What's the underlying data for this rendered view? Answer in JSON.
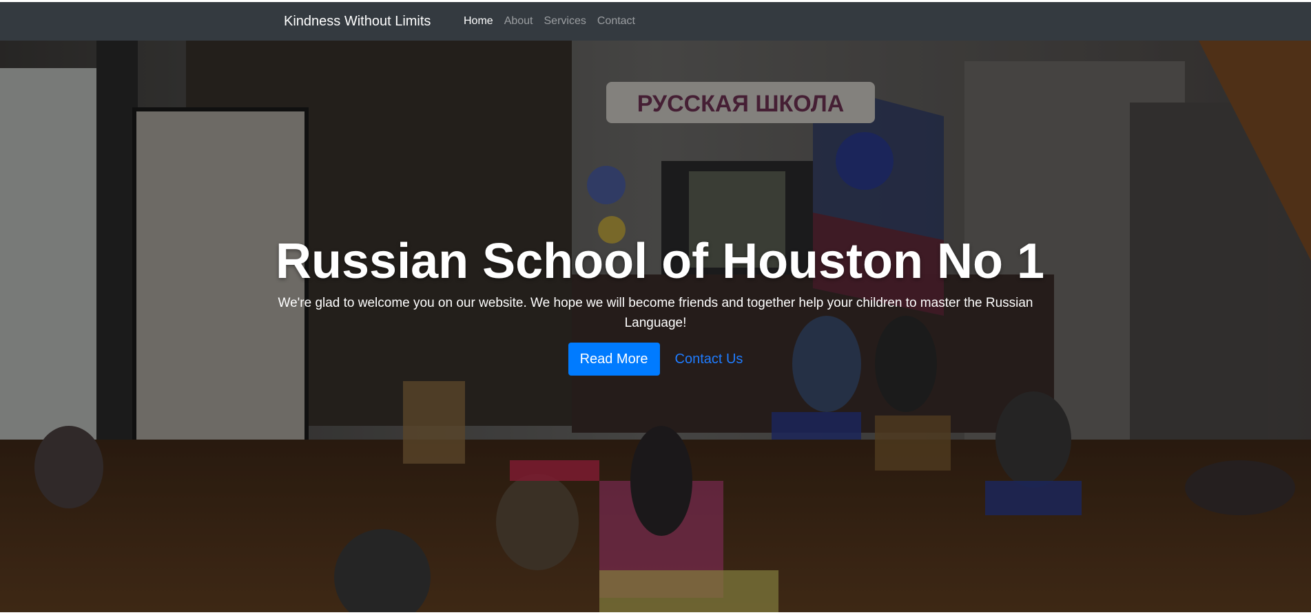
{
  "navbar": {
    "brand": "Kindness Without Limits",
    "links": [
      {
        "label": "Home",
        "active": true
      },
      {
        "label": "About",
        "active": false
      },
      {
        "label": "Services",
        "active": false
      },
      {
        "label": "Contact",
        "active": false
      }
    ]
  },
  "hero": {
    "title": "Russian School of Houston No 1",
    "text": "We're glad to welcome you on our website. We hope we will become friends and together help your children to master the Russian Language!",
    "primary_button": "Read More",
    "secondary_link": "Contact Us",
    "banner_text": "РУССКАЯ ШКОЛА"
  },
  "colors": {
    "navbar_bg": "#343a40",
    "primary": "#007bff",
    "link": "#1f7cff"
  }
}
